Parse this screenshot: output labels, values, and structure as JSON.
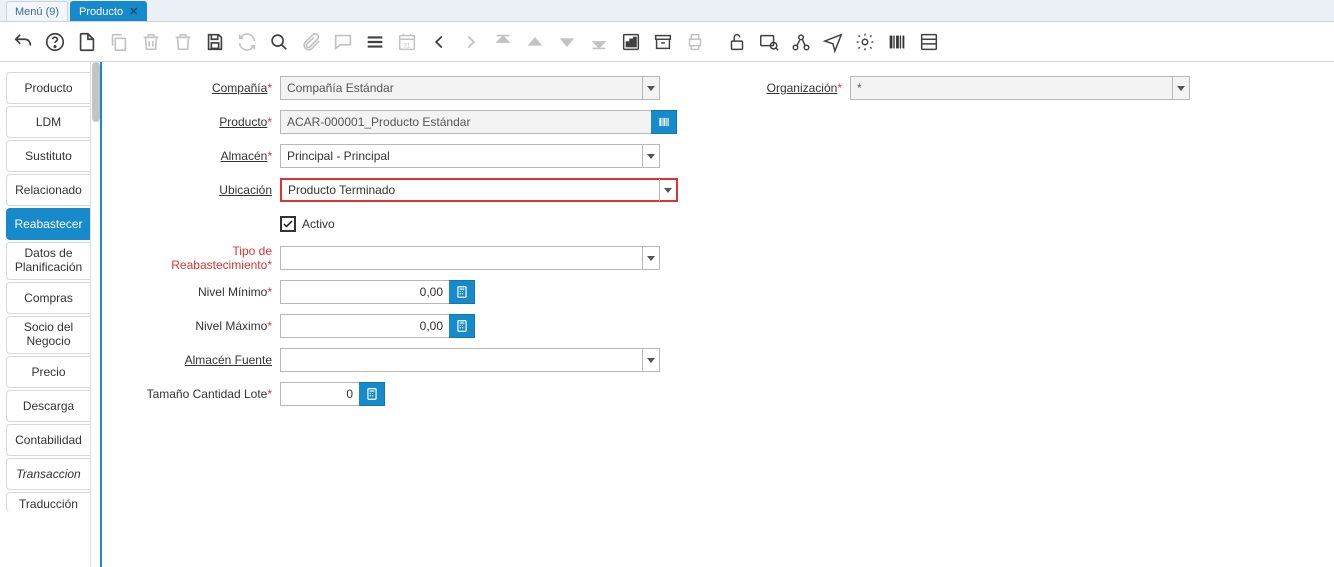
{
  "tabs": {
    "menu": "Menú (9)",
    "active": "Producto"
  },
  "sidetabs": [
    "Producto",
    "LDM",
    "Sustituto",
    "Relacionado",
    "Reabastecer",
    "Datos de Planificación",
    "Compras",
    "Socio del Negocio",
    "Precio",
    "Descarga",
    "Contabilidad",
    "Transaccion",
    "Traducción"
  ],
  "form": {
    "compania_label": "Compañía",
    "compania_value": "Compañía Estándar",
    "organizacion_label": "Organización",
    "organizacion_value": "*",
    "producto_label": "Producto",
    "producto_value": "ACAR-000001_Producto Estándar",
    "almacen_label": "Almacén",
    "almacen_value": "Principal - Principal",
    "ubicacion_label": "Ubicación",
    "ubicacion_value": "Producto Terminado",
    "activo_label": "Activo",
    "activo_checked": true,
    "tipo_reab_label": "Tipo de Reabastecimiento",
    "tipo_reab_value": "",
    "nivel_min_label": "Nivel Mínimo",
    "nivel_min_value": "0,00",
    "nivel_max_label": "Nivel Máximo",
    "nivel_max_value": "0,00",
    "almacen_fuente_label": "Almacén Fuente",
    "almacen_fuente_value": "",
    "tam_lote_label": "Tamaño Cantidad Lote",
    "tam_lote_value": "0"
  }
}
